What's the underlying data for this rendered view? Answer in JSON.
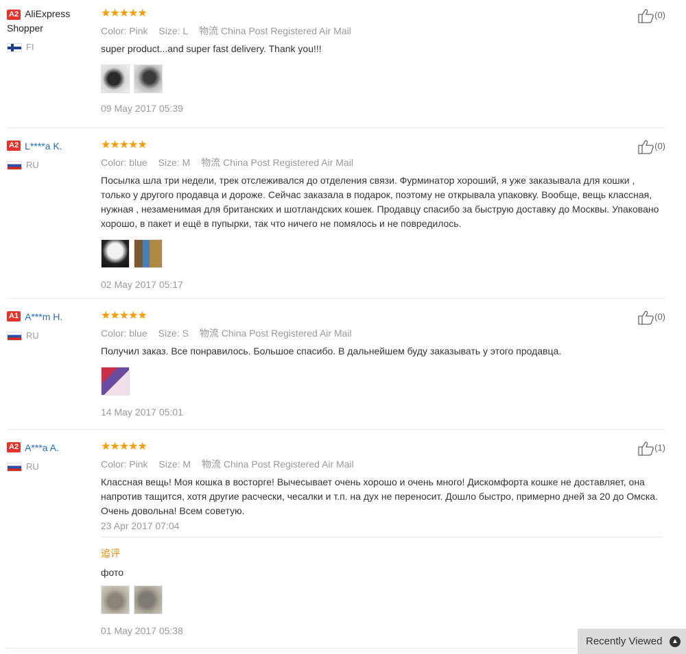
{
  "reviews": [
    {
      "badge": "A2",
      "name": "AliExpress Shopper",
      "country": "FI",
      "stars": "★★★★★",
      "color_label": "Color:",
      "color": "Pink",
      "size_label": "Size:",
      "size": "L",
      "ship_label": "物流",
      "shipping": "China Post Registered Air Mail",
      "text": "super product...and super fast delivery. Thank you!!!",
      "date": "09 May 2017 05:39",
      "likes": "(0)"
    },
    {
      "badge": "A2",
      "name": "L****a K.",
      "country": "RU",
      "stars": "★★★★★",
      "color_label": "Color:",
      "color": "blue",
      "size_label": "Size:",
      "size": "M",
      "ship_label": "物流",
      "shipping": "China Post Registered Air Mail",
      "text": "Посылка шла три недели, трек отслеживался до отделения связи. Фурминатор хороший, я уже заказывала для кошки , только у другого продавца и дороже. Сейчас заказала в подарок, поэтому не открывала упаковку. Вообще, вещь классная, нужная , незаменимая для британских и шотландских кошек. Продавцу спасибо за быструю доставку до Москвы. Упаковано хорошо, в пакет и ещё в пупырки, так что ничего не помялось и не повредилось.",
      "date": "02 May 2017 05:17",
      "likes": "(0)"
    },
    {
      "badge": "A1",
      "name": "A***m H.",
      "country": "RU",
      "stars": "★★★★★",
      "color_label": "Color:",
      "color": "blue",
      "size_label": "Size:",
      "size": "S",
      "ship_label": "物流",
      "shipping": "China Post Registered Air Mail",
      "text": "Получил заказ. Все понравилось. Большое спасибо. В дальнейшем буду заказывать у этого продавца.",
      "date": "14 May 2017 05:01",
      "likes": "(0)"
    },
    {
      "badge": "A2",
      "name": "A***a A.",
      "country": "RU",
      "stars": "★★★★★",
      "color_label": "Color:",
      "color": "Pink",
      "size_label": "Size:",
      "size": "M",
      "ship_label": "物流",
      "shipping": "China Post Registered Air Mail",
      "text": "Классная вещь! Моя кошка в восторге! Вычесывает очень хорошо и очень много! Дискомфорта кошке не доставляет, она напротив тащится, хотя другие расчески, чесалки и т.п. на дух не переносит. Дошло быстро, примерно дней за 20 до Омска. Очень довольна! Всем советую.",
      "date": "23 Apr 2017 07:04",
      "likes": "(1)",
      "append_label": "追评",
      "append_text": "фото",
      "append_date": "01 May 2017 05:38"
    }
  ],
  "recently_viewed": "Recently Viewed"
}
